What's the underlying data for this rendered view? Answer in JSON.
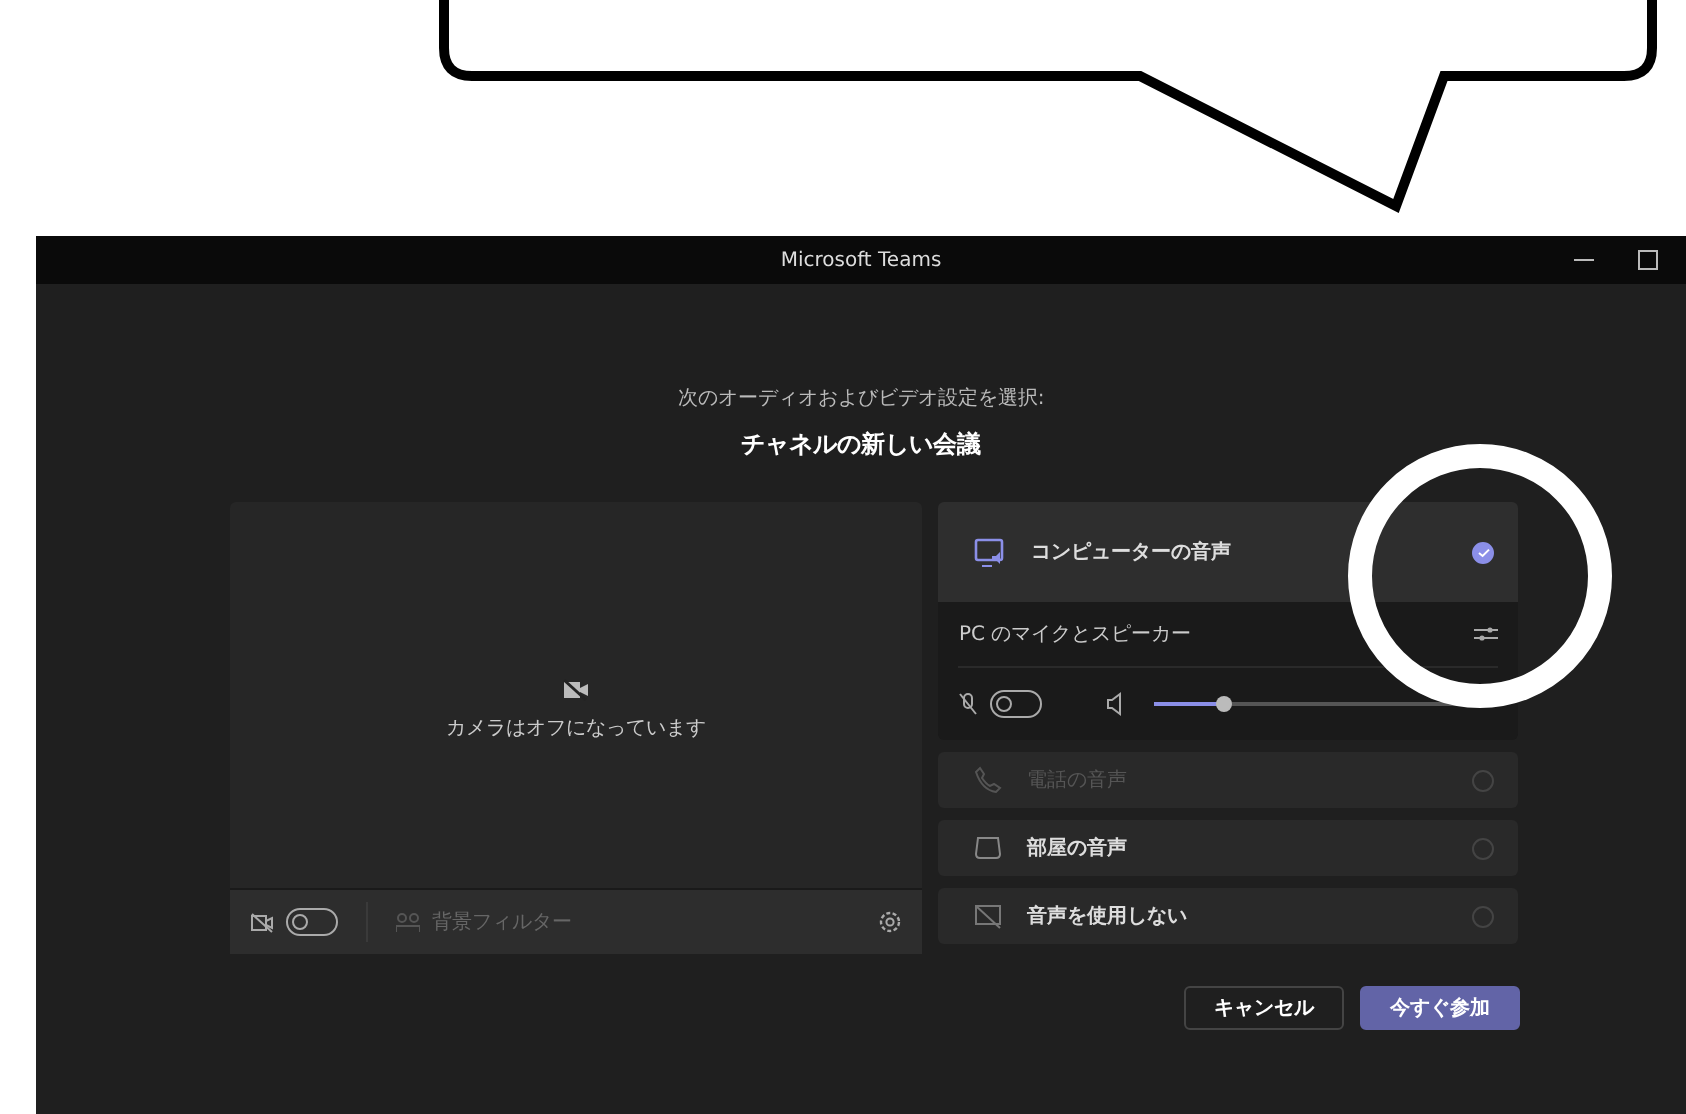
{
  "window": {
    "title": "Microsoft Teams"
  },
  "prompt": "次のオーディオおよびビデオ設定を選択:",
  "meeting_title": "チャネルの新しい会議",
  "camera": {
    "off_message": "カメラはオフになっています",
    "camera_on": false,
    "background_filter": "背景フィルター"
  },
  "audio_options": [
    {
      "label": "コンピューターの音声",
      "selected": true,
      "disabled": false,
      "kind": "computer"
    },
    {
      "label": "電話の音声",
      "selected": false,
      "disabled": true,
      "kind": "phone"
    },
    {
      "label": "部屋の音声",
      "selected": false,
      "disabled": false,
      "kind": "room"
    },
    {
      "label": "音声を使用しない",
      "selected": false,
      "disabled": false,
      "kind": "none"
    }
  ],
  "device_panel": {
    "label": "PC のマイクとスピーカー",
    "mic_on": false,
    "volume": {
      "level": 0.2
    }
  },
  "buttons": [
    {
      "label": "キャンセル",
      "kind": "secondary"
    },
    {
      "label": "今すぐ参加",
      "kind": "primary"
    }
  ]
}
